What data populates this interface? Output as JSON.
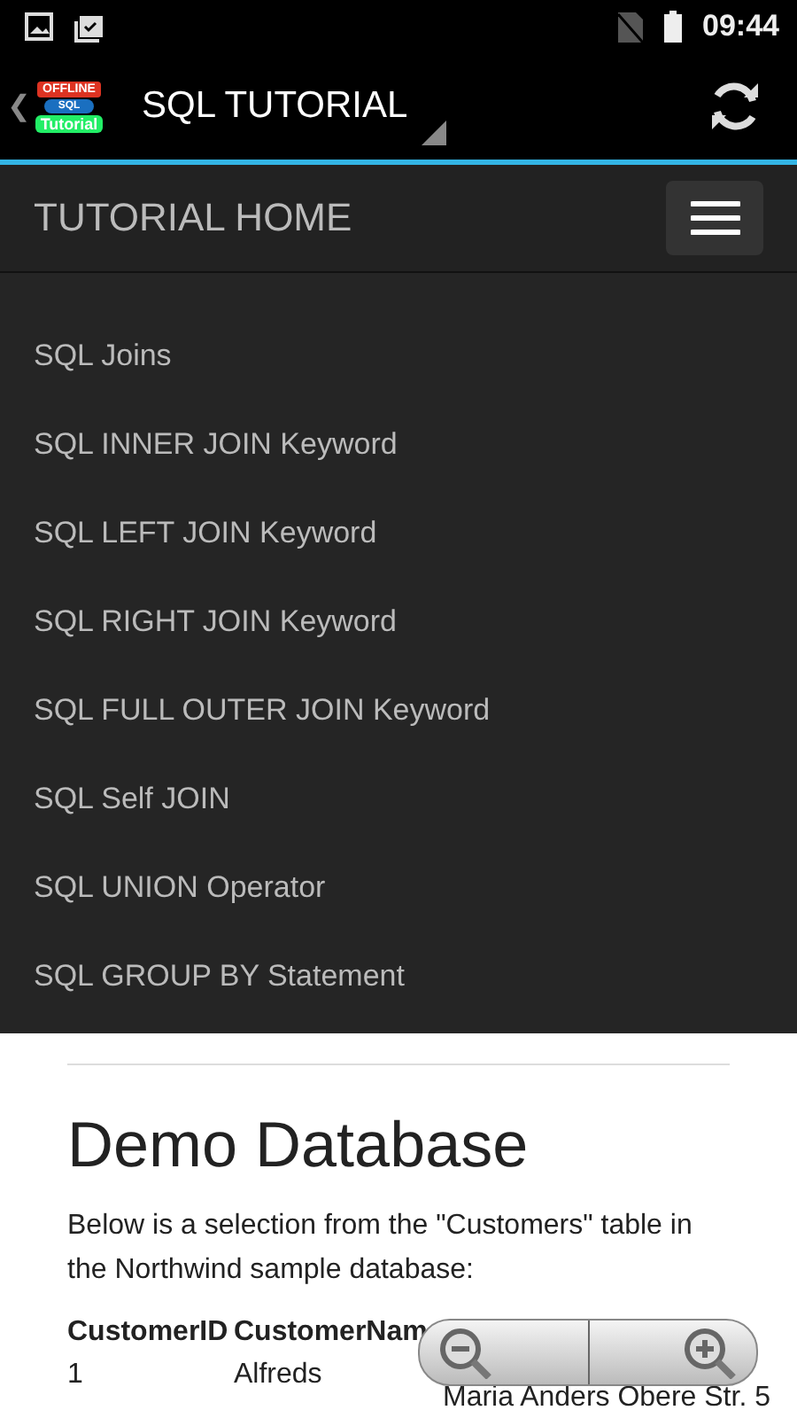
{
  "status_bar": {
    "time": "09:44"
  },
  "action_bar": {
    "logo": {
      "top": "OFFLINE",
      "middle": "SQL",
      "bottom": "Tutorial"
    },
    "back": "❮",
    "title": "SQL TUTORIAL"
  },
  "nav": {
    "title": "TUTORIAL HOME"
  },
  "menu": {
    "items": [
      {
        "label": "SQL Joins"
      },
      {
        "label": "SQL INNER JOIN Keyword"
      },
      {
        "label": "SQL LEFT JOIN Keyword"
      },
      {
        "label": "SQL RIGHT JOIN Keyword"
      },
      {
        "label": "SQL FULL OUTER JOIN Keyword"
      },
      {
        "label": "SQL Self JOIN"
      },
      {
        "label": "SQL UNION Operator"
      },
      {
        "label": "SQL GROUP BY Statement"
      }
    ]
  },
  "content": {
    "heading": "Demo Database",
    "intro": "Below is a selection from the \"Customers\" table in the Northwind sample database:",
    "table": {
      "columns": [
        "CustomerID",
        "CustomerNam"
      ],
      "rows": [
        [
          "1",
          "Alfreds",
          "Maria Anders Obere Str. 5"
        ]
      ]
    }
  }
}
